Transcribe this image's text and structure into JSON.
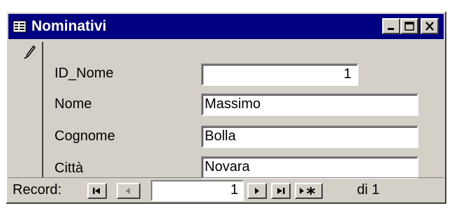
{
  "window": {
    "title": "Nominativi",
    "controls": {
      "minimize": "minimize-icon",
      "maximize": "maximize-icon",
      "close": "close-icon"
    }
  },
  "record_selector_icon": "pencil-edit-icon",
  "fields": [
    {
      "label": "ID_Nome",
      "value": "1"
    },
    {
      "label": "Nome",
      "value": "Massimo"
    },
    {
      "label": "Cognome",
      "value": "Bolla"
    },
    {
      "label": "Città",
      "value": "Novara"
    }
  ],
  "navigation": {
    "label": "Record:",
    "current": "1",
    "total_text": "di 1",
    "buttons": [
      "first-record-icon",
      "previous-record-icon",
      "next-record-icon",
      "last-record-icon",
      "new-record-icon"
    ]
  },
  "colors": {
    "titlebar": "#000080",
    "face": "#d4d0c8",
    "field": "#ffffff"
  }
}
